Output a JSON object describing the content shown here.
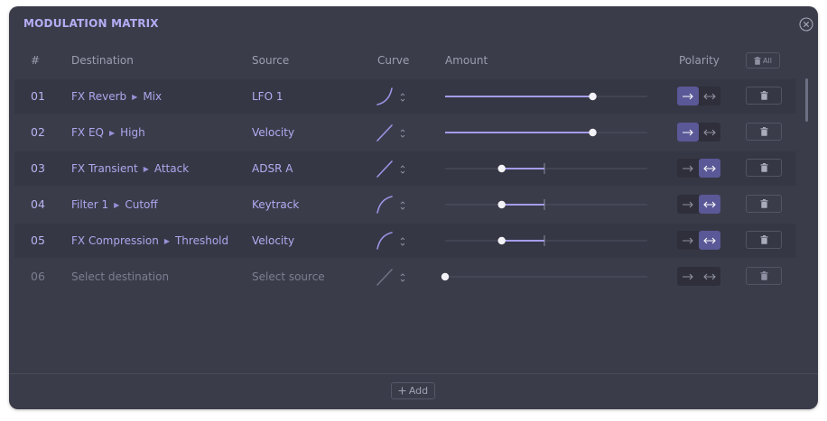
{
  "title": "MODULATION MATRIX",
  "headers": {
    "num": "#",
    "destination": "Destination",
    "source": "Source",
    "curve": "Curve",
    "amount": "Amount",
    "polarity": "Polarity",
    "clear_all": "All"
  },
  "rows": [
    {
      "num": "01",
      "dest_module": "FX Reverb",
      "dest_param": "Mix",
      "source": "LFO 1",
      "curve": "exp",
      "amount": 0.73,
      "bipolar_center": false,
      "polarity": "unipolar",
      "state": "active"
    },
    {
      "num": "02",
      "dest_module": "FX EQ",
      "dest_param": "High",
      "source": "Velocity",
      "curve": "linear",
      "amount": 0.73,
      "bipolar_center": false,
      "polarity": "unipolar",
      "state": "active"
    },
    {
      "num": "03",
      "dest_module": "FX Transient",
      "dest_param": "Attack",
      "source": "ADSR A",
      "curve": "linear",
      "amount": -0.43,
      "bipolar_center": true,
      "polarity": "bipolar",
      "state": "active"
    },
    {
      "num": "04",
      "dest_module": "Filter 1",
      "dest_param": "Cutoff",
      "source": "Keytrack",
      "curve": "log",
      "amount": -0.43,
      "bipolar_center": true,
      "polarity": "bipolar",
      "state": "active"
    },
    {
      "num": "05",
      "dest_module": "FX Compression",
      "dest_param": "Threshold",
      "source": "Velocity",
      "curve": "log",
      "amount": -0.43,
      "bipolar_center": true,
      "polarity": "bipolar",
      "state": "active"
    },
    {
      "num": "06",
      "dest_placeholder": "Select destination",
      "source_placeholder": "Select source",
      "curve": "linear",
      "amount": 0,
      "bipolar_center": false,
      "polarity": "none",
      "state": "empty"
    }
  ],
  "footer": {
    "add_label": "Add"
  },
  "colors": {
    "panel": "#3b3c4a",
    "accent": "#b5acf3",
    "slider_active": "#a49cec",
    "track": "#4f5162",
    "polarity_active": "#5a5897"
  },
  "icons": {
    "close": "close-circle-icon",
    "trash": "trash-icon",
    "add": "plus-icon",
    "unipolar": "arrow-right-icon",
    "bipolar": "arrows-left-right-icon",
    "curve_arrows": "chevron-up-down-icon"
  }
}
